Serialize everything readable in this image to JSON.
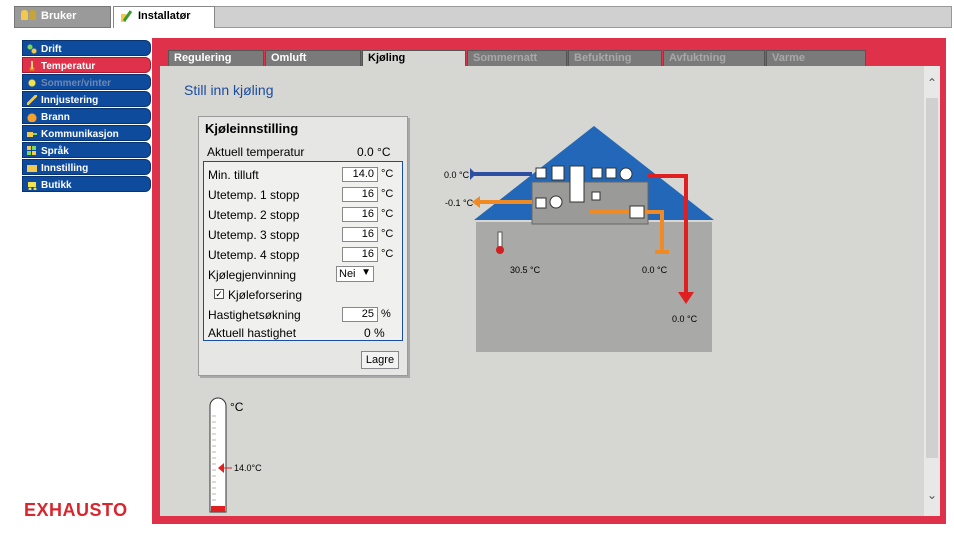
{
  "top_tabs": {
    "user": "Bruker",
    "installer": "Installatør"
  },
  "sidebar": {
    "items": [
      {
        "label": "Drift",
        "icon": "drift-icon"
      },
      {
        "label": "Temperatur",
        "icon": "thermometer-icon"
      },
      {
        "label": "Sommer/vinter",
        "icon": "sun-icon"
      },
      {
        "label": "Innjustering",
        "icon": "pen-icon"
      },
      {
        "label": "Brann",
        "icon": "fire-icon"
      },
      {
        "label": "Kommunikasjon",
        "icon": "communication-icon"
      },
      {
        "label": "Språk",
        "icon": "language-icon"
      },
      {
        "label": "Innstilling",
        "icon": "settings-icon"
      },
      {
        "label": "Butikk",
        "icon": "cart-icon"
      }
    ]
  },
  "logo": "EXHAUSTO",
  "subtabs": [
    "Regulering",
    "Omluft",
    "Kjøling",
    "Sommernatt",
    "Befuktning",
    "Avfuktning",
    "Varme"
  ],
  "page_title": "Still inn kjøling",
  "panel": {
    "title": "Kjøleinnstilling",
    "aktuell_temp_label": "Aktuell temperatur",
    "aktuell_temp_value": "0.0 °C",
    "rows": [
      {
        "label": "Min. tilluft",
        "value": "14.0",
        "unit": "°C"
      },
      {
        "label": "Utetemp. 1 stopp",
        "value": "16",
        "unit": "°C"
      },
      {
        "label": "Utetemp. 2 stopp",
        "value": "16",
        "unit": "°C"
      },
      {
        "label": "Utetemp. 3 stopp",
        "value": "16",
        "unit": "°C"
      },
      {
        "label": "Utetemp. 4 stopp",
        "value": "16",
        "unit": "°C"
      }
    ],
    "kjolegjenvinning_label": "Kjølegjenvinning",
    "kjolegjenvinning_value": "Nei",
    "kjoleforsering_label": "Kjøleforsering",
    "kjoleforsering_checked": "✓",
    "hastighetsokning_label": "Hastighetsøkning",
    "hastighetsokning_value": "25",
    "hastighetsokning_unit": "%",
    "aktuell_hastighet_label": "Aktuell hastighet",
    "aktuell_hastighet_value": "0 %",
    "save_label": "Lagre"
  },
  "diagram": {
    "supply_in": "0.0 °C",
    "exhaust_out": "-0.1 °C",
    "room_temp": "30.5 °C",
    "extract_temp": "0.0 °C",
    "supply_temp": "0.0 °C"
  },
  "thermometer": {
    "unit": "°C",
    "setpoint": "14.0°C"
  },
  "colors": {
    "frame": "#e0314a",
    "nav": "#0e4b9c",
    "supply": "#2c4fa3",
    "exhaust": "#f08a24",
    "hot": "#e02020"
  }
}
